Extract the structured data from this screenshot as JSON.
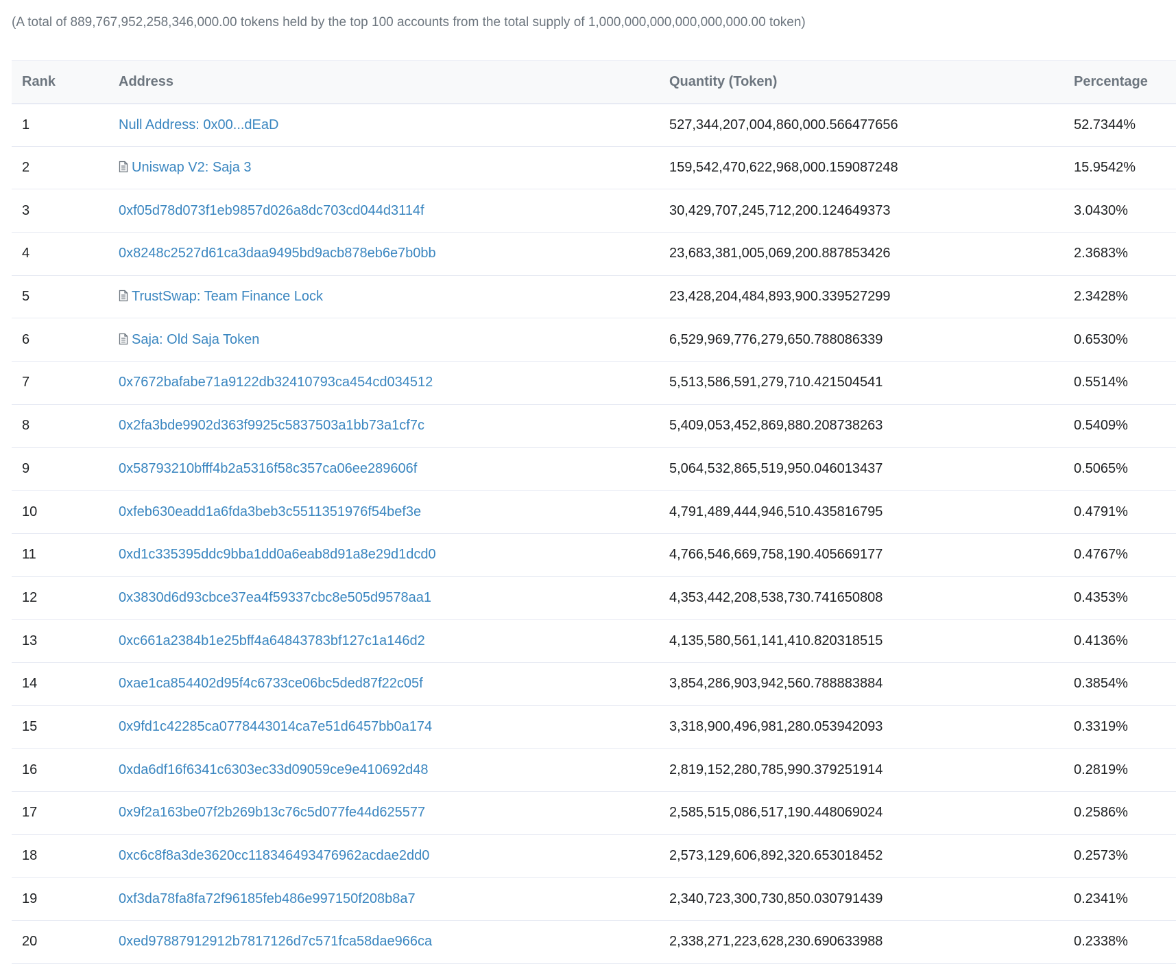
{
  "summary": "(A total of 889,767,952,258,346,000.00 tokens held by the top 100 accounts from the total supply of 1,000,000,000,000,000,000.00 token)",
  "columns": {
    "rank": "Rank",
    "address": "Address",
    "quantity": "Quantity (Token)",
    "percentage": "Percentage"
  },
  "colors": {
    "link": "#3a86c0",
    "header_bg": "#f8f9fa",
    "border": "#e7eaf3",
    "muted": "#6c757e"
  },
  "rows": [
    {
      "rank": "1",
      "address": "Null Address: 0x00...dEaD",
      "contract": false,
      "quantity": "527,344,207,004,860,000.566477656",
      "percentage": "52.7344%"
    },
    {
      "rank": "2",
      "address": "Uniswap V2: Saja 3",
      "contract": true,
      "quantity": "159,542,470,622,968,000.159087248",
      "percentage": "15.9542%"
    },
    {
      "rank": "3",
      "address": "0xf05d78d073f1eb9857d026a8dc703cd044d3114f",
      "contract": false,
      "quantity": "30,429,707,245,712,200.124649373",
      "percentage": "3.0430%"
    },
    {
      "rank": "4",
      "address": "0x8248c2527d61ca3daa9495bd9acb878eb6e7b0bb",
      "contract": false,
      "quantity": "23,683,381,005,069,200.887853426",
      "percentage": "2.3683%"
    },
    {
      "rank": "5",
      "address": "TrustSwap: Team Finance Lock",
      "contract": true,
      "quantity": "23,428,204,484,893,900.339527299",
      "percentage": "2.3428%"
    },
    {
      "rank": "6",
      "address": "Saja: Old Saja Token",
      "contract": true,
      "quantity": "6,529,969,776,279,650.788086339",
      "percentage": "0.6530%"
    },
    {
      "rank": "7",
      "address": "0x7672bafabe71a9122db32410793ca454cd034512",
      "contract": false,
      "quantity": "5,513,586,591,279,710.421504541",
      "percentage": "0.5514%"
    },
    {
      "rank": "8",
      "address": "0x2fa3bde9902d363f9925c5837503a1bb73a1cf7c",
      "contract": false,
      "quantity": "5,409,053,452,869,880.208738263",
      "percentage": "0.5409%"
    },
    {
      "rank": "9",
      "address": "0x58793210bfff4b2a5316f58c357ca06ee289606f",
      "contract": false,
      "quantity": "5,064,532,865,519,950.046013437",
      "percentage": "0.5065%"
    },
    {
      "rank": "10",
      "address": "0xfeb630eadd1a6fda3beb3c5511351976f54bef3e",
      "contract": false,
      "quantity": "4,791,489,444,946,510.435816795",
      "percentage": "0.4791%"
    },
    {
      "rank": "11",
      "address": "0xd1c335395ddc9bba1dd0a6eab8d91a8e29d1dcd0",
      "contract": false,
      "quantity": "4,766,546,669,758,190.405669177",
      "percentage": "0.4767%"
    },
    {
      "rank": "12",
      "address": "0x3830d6d93cbce37ea4f59337cbc8e505d9578aa1",
      "contract": false,
      "quantity": "4,353,442,208,538,730.741650808",
      "percentage": "0.4353%"
    },
    {
      "rank": "13",
      "address": "0xc661a2384b1e25bff4a64843783bf127c1a146d2",
      "contract": false,
      "quantity": "4,135,580,561,141,410.820318515",
      "percentage": "0.4136%"
    },
    {
      "rank": "14",
      "address": "0xae1ca854402d95f4c6733ce06bc5ded87f22c05f",
      "contract": false,
      "quantity": "3,854,286,903,942,560.788883884",
      "percentage": "0.3854%"
    },
    {
      "rank": "15",
      "address": "0x9fd1c42285ca0778443014ca7e51d6457bb0a174",
      "contract": false,
      "quantity": "3,318,900,496,981,280.053942093",
      "percentage": "0.3319%"
    },
    {
      "rank": "16",
      "address": "0xda6df16f6341c6303ec33d09059ce9e410692d48",
      "contract": false,
      "quantity": "2,819,152,280,785,990.379251914",
      "percentage": "0.2819%"
    },
    {
      "rank": "17",
      "address": "0x9f2a163be07f2b269b13c76c5d077fe44d625577",
      "contract": false,
      "quantity": "2,585,515,086,517,190.448069024",
      "percentage": "0.2586%"
    },
    {
      "rank": "18",
      "address": "0xc6c8f8a3de3620cc118346493476962acdae2dd0",
      "contract": false,
      "quantity": "2,573,129,606,892,320.653018452",
      "percentage": "0.2573%"
    },
    {
      "rank": "19",
      "address": "0xf3da78fa8fa72f96185feb486e997150f208b8a7",
      "contract": false,
      "quantity": "2,340,723,300,730,850.030791439",
      "percentage": "0.2341%"
    },
    {
      "rank": "20",
      "address": "0xed97887912912b7817126d7c571fca58dae966ca",
      "contract": false,
      "quantity": "2,338,271,223,628,230.690633988",
      "percentage": "0.2338%"
    }
  ]
}
